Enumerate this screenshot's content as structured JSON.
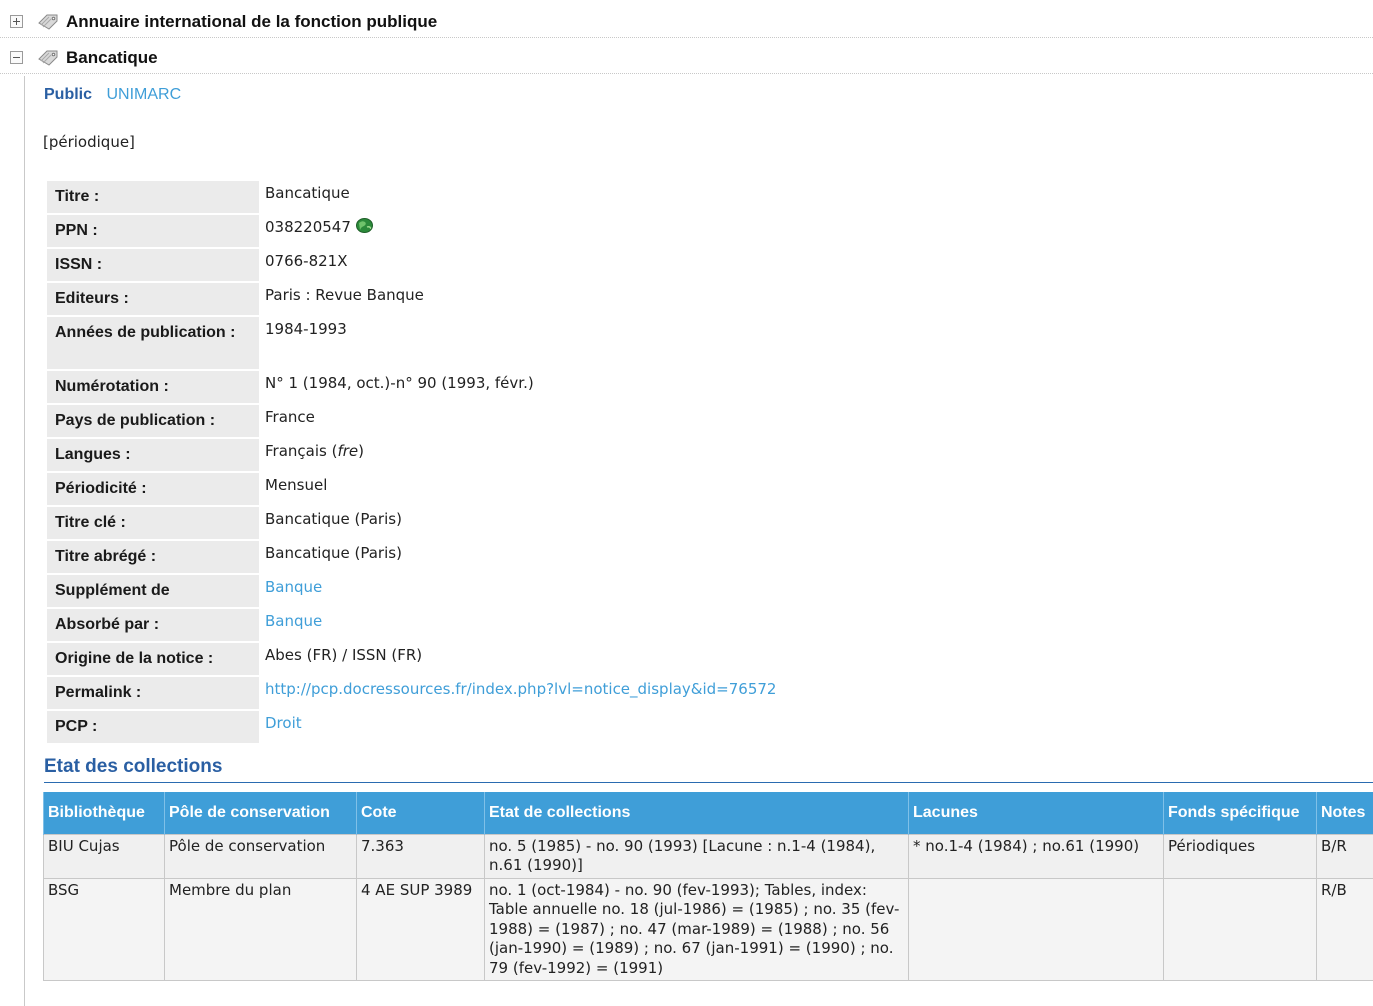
{
  "notices": [
    {
      "title": "Annuaire international de la fonction publique",
      "toggle": "expand"
    },
    {
      "title": "Bancatique",
      "toggle": "collapse"
    }
  ],
  "tabs": {
    "public": "Public",
    "unimarc": "UNIMARC"
  },
  "doc_type": "[périodique]",
  "details": [
    {
      "label": "Titre :",
      "value": "Bancatique"
    },
    {
      "label": "PPN :",
      "value": "038220547"
    },
    {
      "label": "ISSN :",
      "value": "0766-821X"
    },
    {
      "label": "Editeurs :",
      "value": "Paris : Revue Banque"
    },
    {
      "label": "Années de publication :",
      "value": "1984-1993"
    },
    {
      "label": "Numérotation :",
      "value": "N° 1 (1984, oct.)-n° 90 (1993, févr.)"
    },
    {
      "label": "Pays de publication :",
      "value": "France"
    },
    {
      "label": "Langues :",
      "value": "Français",
      "code": "fre"
    },
    {
      "label": "Périodicité :",
      "value": "Mensuel"
    },
    {
      "label": "Titre clé :",
      "value": "Bancatique (Paris)"
    },
    {
      "label": "Titre abrégé :",
      "value": "Bancatique (Paris)"
    },
    {
      "label": "Supplément de",
      "value": "Banque"
    },
    {
      "label": "Absorbé par :",
      "value": "Banque"
    },
    {
      "label": "Origine de la notice :",
      "value": "Abes (FR) / ISSN (FR)"
    },
    {
      "label": "Permalink :",
      "value": "http://pcp.docressources.fr/index.php?lvl=notice_display&id=76572"
    },
    {
      "label": "PCP :",
      "value": "Droit"
    }
  ],
  "collections": {
    "title": "Etat des collections",
    "headers": [
      "Bibliothèque",
      "Pôle de conservation",
      "Cote",
      "Etat de collections",
      "Lacunes",
      "Fonds spécifique",
      "Notes"
    ],
    "rows": [
      [
        "BIU Cujas",
        "Pôle de conservation",
        "7.363",
        "no. 5 (1985) - no. 90 (1993) [Lacune : n.1-4 (1984), n.61 (1990)]",
        "* no.1-4 (1984) ; no.61 (1990)",
        "Périodiques",
        "B/R"
      ],
      [
        "BSG",
        "Membre du plan",
        "4 AE SUP 3989",
        "no. 1 (oct-1984) - no. 90 (fev-1993); Tables, index: Table annuelle no. 18 (jul-1986) = (1985) ; no. 35 (fev-1988) = (1987) ; no. 47 (mar-1989) = (1988) ; no. 56 (jan-1990) = (1989) ; no. 67 (jan-1991) = (1990) ; no. 79 (fev-1992) = (1991)",
        "",
        "",
        "R/B"
      ]
    ]
  },
  "colors": {
    "link": "#3f9ed8",
    "heading": "#2a5fa3",
    "table_header": "#3f9ed8",
    "label_bg": "#ebebeb"
  }
}
